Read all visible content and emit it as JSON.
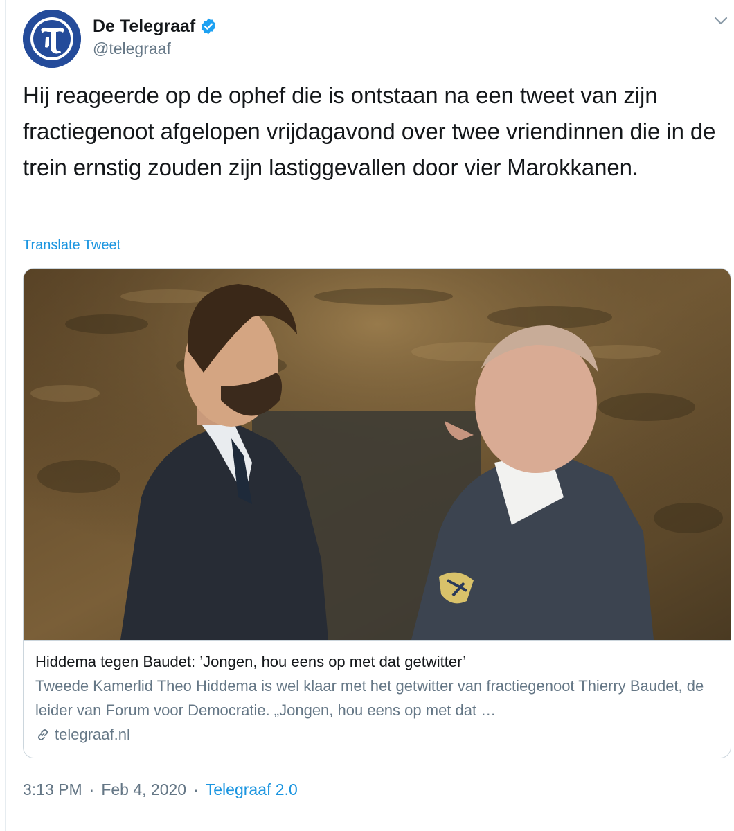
{
  "author": {
    "name": "De Telegraaf",
    "handle": "@telegraaf",
    "verified": true,
    "avatar_icon": "telegraaf-logo",
    "brand_color": "#244b9a"
  },
  "menu_icon": "chevron-down-icon",
  "tweet": {
    "text": "Hij reageerde op de ophef die is ontstaan na een tweet van zijn fractiegenoot afgelopen vrijdagavond over twee vriendinnen die in de trein ernstig zouden zijn lastiggevallen door vier Marokkanen.",
    "translate_label": "Translate Tweet"
  },
  "card": {
    "image_description_icon": "article-photo",
    "title": "Hiddema tegen Baudet: ’Jongen, hou eens op met dat getwitter’",
    "description": "Tweede Kamerlid Theo Hiddema is wel klaar met het getwitter van fractiegenoot Thierry Baudet, de leider van Forum voor Democratie. „Jongen, hou eens op met dat …",
    "domain": "telegraaf.nl",
    "link_icon": "link-icon"
  },
  "footer": {
    "time": "3:13 PM",
    "separator": "·",
    "date": "Feb 4, 2020",
    "source": "Telegraaf 2.0"
  },
  "colors": {
    "link": "#1b95e0",
    "secondary_text": "#657786",
    "border": "#ccd6dd"
  }
}
